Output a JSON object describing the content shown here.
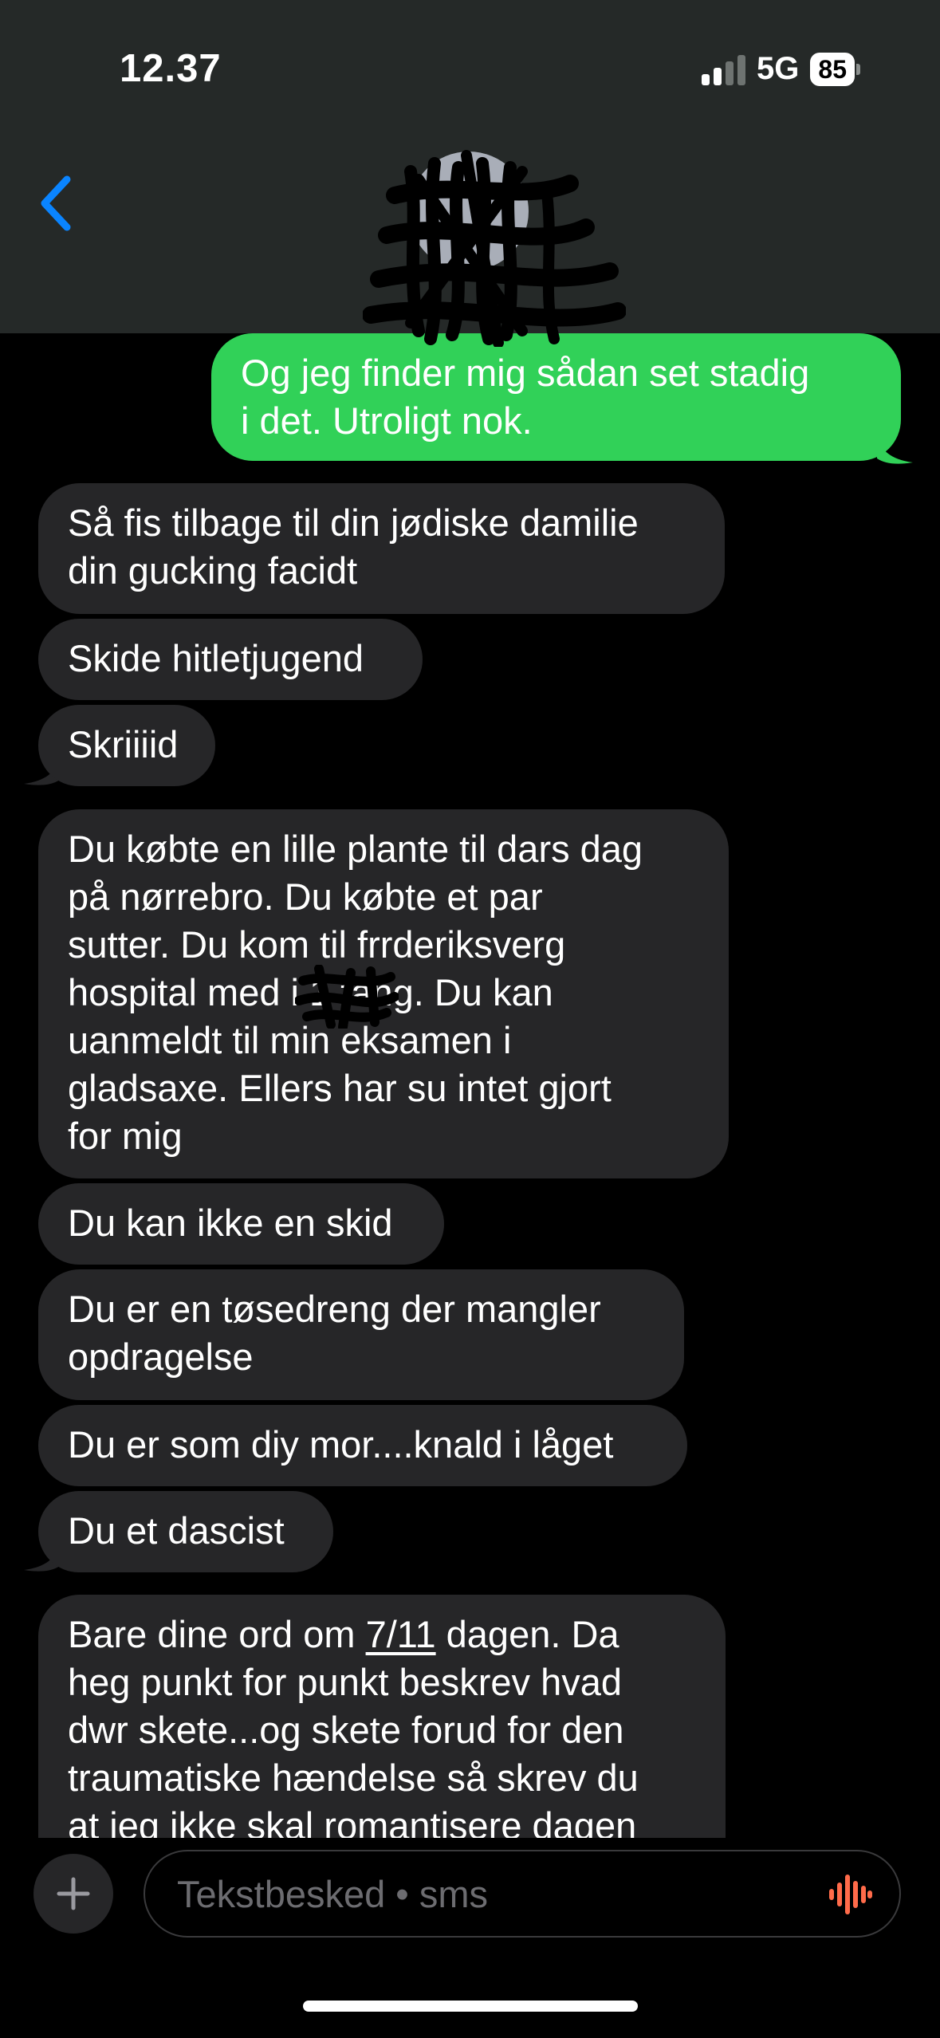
{
  "status_bar": {
    "time": "12.37",
    "network": "5G",
    "battery": "85"
  },
  "conversation": {
    "messages": [
      {
        "id": "m1",
        "direction": "outgoing",
        "text": "Og jeg finder mig sådan set stadig\ni det. Utroligt nok."
      },
      {
        "id": "m2",
        "direction": "incoming",
        "text": "Så fis tilbage til din jødiske damilie\ndin gucking facidt"
      },
      {
        "id": "m3",
        "direction": "incoming",
        "text": "Skide hitletjugend"
      },
      {
        "id": "m4",
        "direction": "incoming",
        "text": "Skriiiid"
      },
      {
        "id": "m5",
        "direction": "incoming",
        "text": "Du købte en lille plante til dars dag\npå nørrebro. Du købte et par\nsutter. Du kom til frrderiksverg\nhospital med i     1 fang. Du kan\nuanmeldt til min eksamen i\ngladsaxe. Ellers har su intet gjort\nfor mig"
      },
      {
        "id": "m6",
        "direction": "incoming",
        "text": "Du kan ikke en skid"
      },
      {
        "id": "m7",
        "direction": "incoming",
        "text": "Du er en tøsedreng der mangler\nopdragelse"
      },
      {
        "id": "m8",
        "direction": "incoming",
        "text": "Du er som diy mor....knald i låget"
      },
      {
        "id": "m9",
        "direction": "incoming",
        "text": "Du et dascist"
      },
      {
        "id": "m10",
        "direction": "incoming",
        "text_before_link": "Bare dine ord om ",
        "link_text": "7/11",
        "text_after_link": " dagen. Da\nheg punkt for punkt beskrev hvad\ndwr skete...og skete forud for den\ntraumatiske hændelse så skrev du\nat jeg ikke skal romantisere dagen"
      }
    ]
  },
  "composer": {
    "placeholder": "Tekstbesked • sms"
  },
  "colors": {
    "header_bg": "#252928",
    "incoming_bubble": "#262628",
    "outgoing_bubble": "#31d158",
    "back_chevron": "#0a84ff",
    "voice_icon": "#ff6b4a",
    "background": "#000000"
  },
  "icons": {
    "back": "chevron-left-icon",
    "plus": "plus-icon",
    "voice": "waveform-icon",
    "contact": "contact-avatar-redacted"
  }
}
